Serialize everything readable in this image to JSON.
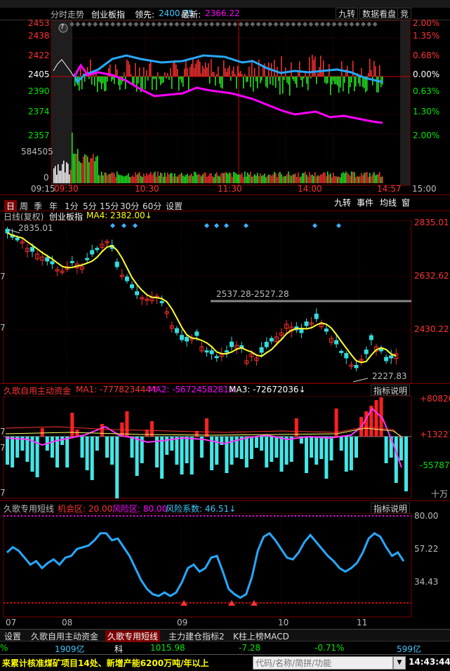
{
  "header": {
    "title": "分时走势",
    "index": "创业板指",
    "lead_label": "领先:",
    "lead_value": "2400.75",
    "latest_label": "最新:",
    "latest_value": "2366.22",
    "btn_jiuzhuan": "九转",
    "btn_data": "数据看盘",
    "btn_jing": "竞"
  },
  "intraday": {
    "left_prices": [
      "2453",
      "2438",
      "2422",
      "2405",
      "2390",
      "2374",
      "2357"
    ],
    "right_pcts": [
      "2.00%",
      "1.35%",
      "0.68%",
      "0.00%",
      "0.63%",
      "1.30%",
      "2.00%"
    ],
    "volume_label": "584505",
    "volume_zero": "0",
    "time_labels": [
      "09:15",
      "09:30",
      "10:30",
      "11:30",
      "14:00",
      "14:57",
      "15:00"
    ],
    "help": "?"
  },
  "period_tabs": [
    "日",
    "周",
    "季",
    "年",
    "1分",
    "5分",
    "15分",
    "30分",
    "60分",
    "设置"
  ],
  "right_tabs": [
    "九转",
    "事件",
    "均线",
    "窗"
  ],
  "kline": {
    "title": "日线(复权)",
    "index": "创业板指",
    "ma_label": "MA4: 2382.00↓",
    "right_prices": [
      "2835.01",
      "2632.62",
      "2430.22"
    ],
    "left_marks": [
      "7",
      "7"
    ],
    "high_label": "2835.01",
    "range_label": "2537.28-2527.28",
    "low_label": "2227.83"
  },
  "fund": {
    "title": "久歌自用主动资金",
    "ma1": "MA1: -777823444↑",
    "ma2": "MA2: -5672458281↓",
    "ma3": "MA3: -72672036↓",
    "btn": "指标说明",
    "right_vals": [
      "+80820",
      "+13221",
      "-55787"
    ],
    "unit": "十万",
    "left_marks": [
      "7",
      "7",
      "7"
    ]
  },
  "short": {
    "title": "久歌专用短线",
    "chance": "机会区: 20.00",
    "risk": "风险区: 80.00",
    "coef": "风险系数: 46.51↓",
    "btn": "指标说明",
    "right_vals": [
      "80.00",
      "57.22",
      "34.43"
    ],
    "month_labels": [
      "07",
      "08",
      "09",
      "10",
      "11"
    ],
    "chart_data": {
      "type": "line",
      "name": "风险系数",
      "values": [
        58,
        64,
        60,
        52,
        44,
        48,
        40,
        46,
        50,
        44,
        52,
        54,
        62,
        64,
        66,
        72,
        80,
        80,
        72,
        74,
        64,
        54,
        40,
        26,
        16,
        10,
        8,
        12,
        8,
        12,
        24,
        40,
        44,
        36,
        40,
        52,
        54,
        36,
        16,
        10,
        6,
        10,
        30,
        60,
        76,
        80,
        72,
        62,
        52,
        50,
        58,
        70,
        78,
        70,
        62,
        54,
        48,
        40,
        36,
        40,
        46,
        58,
        74,
        80,
        76,
        64,
        54,
        58,
        48
      ],
      "ylim": [
        0,
        100
      ]
    }
  },
  "bottom_tabs": [
    "设置",
    "久歌自用主动资金",
    "久歌专用短线",
    "主力建仓指标2",
    "K柱上榜MACD"
  ],
  "ticker": {
    "pct": "%",
    "amt1": "1909亿",
    "ke": "科",
    "price": "1015.98",
    "chg": "-7.28",
    "chg_pct": "-0.71%",
    "amt2": "599亿"
  },
  "news": "来累计核准煤矿项目14处、新增产能6200万吨/年以上",
  "search": {
    "placeholder": "代码/名称/简拼/功能"
  },
  "clock": "14:43:44"
}
